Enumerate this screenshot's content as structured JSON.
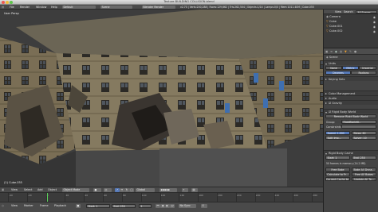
{
  "window": {
    "title": "Texture BUILDING COLLISION.blend"
  },
  "info_header": {
    "menus": [
      "File",
      "Render",
      "Window",
      "Help"
    ],
    "layout": "Default",
    "scene": "Scene",
    "engine": "Blender Render",
    "stats": "v2.70 | Verts:200,288 | Faces:129,662 | Tris:262,504 | Objects:1/14 | Lamps:0/0 | Mem:1011.40M | Cube.055"
  },
  "viewport": {
    "label": "User Persp",
    "object_label": "(1) Cube.055"
  },
  "outliner": {
    "header_buttons": [
      "View",
      "Search",
      "All Scenes"
    ],
    "items": [
      "Camera",
      "Cube",
      "Cube.001",
      "Cube.002"
    ]
  },
  "properties": {
    "tabs": [
      "Scene"
    ],
    "units_panel": "Units",
    "unit_buttons": [
      "None",
      "Metric",
      "Imperial"
    ],
    "unit_row2": [
      "Degrees",
      "Radians"
    ],
    "keying_sets": "Keying Sets",
    "color_mgmt": "Color Management",
    "audio": "Audio",
    "gravity": "Gravity",
    "rigid_world": "Rigid Body World",
    "remove_btn": "Remove Rigid Body World",
    "group_label": "Group:",
    "group_value": "RigidBodyW...",
    "constraints_label": "Constraints:",
    "speed": "Speed: 1.000",
    "split": "Split Imp...",
    "steps": "Steps: 60",
    "solver": "Solver: 10",
    "rb_cache": "Rigid Body Cache",
    "start": "Start: 1",
    "end": "End: 250",
    "cache_info": "50 frames in memory (14.2 MB)",
    "bake_buttons": [
      "Free Bake",
      "Bake All Dyna...",
      "Calculate to Fr...",
      "Free All Bakes",
      "Current Cache to Bake",
      "Update All To..."
    ]
  },
  "viewport_header": {
    "items": [
      "View",
      "Select",
      "Add",
      "Object"
    ],
    "mode": "Object Mode",
    "pivot": "Global"
  },
  "timeline": {
    "ticks": [
      "-40",
      "-20",
      "0",
      "20",
      "40",
      "60",
      "80",
      "100",
      "120",
      "140",
      "160",
      "180",
      "200",
      "220",
      "240",
      "260",
      "280"
    ]
  },
  "timeline_header": {
    "menus": [
      "View",
      "Marker",
      "Frame",
      "Playback"
    ],
    "start": "Start: 1",
    "end": "End: 250",
    "current": "1",
    "sync": "No Sync"
  },
  "colors": {
    "accent": "#5679b8",
    "wall": "#7a6e55",
    "sky": "#333333"
  }
}
